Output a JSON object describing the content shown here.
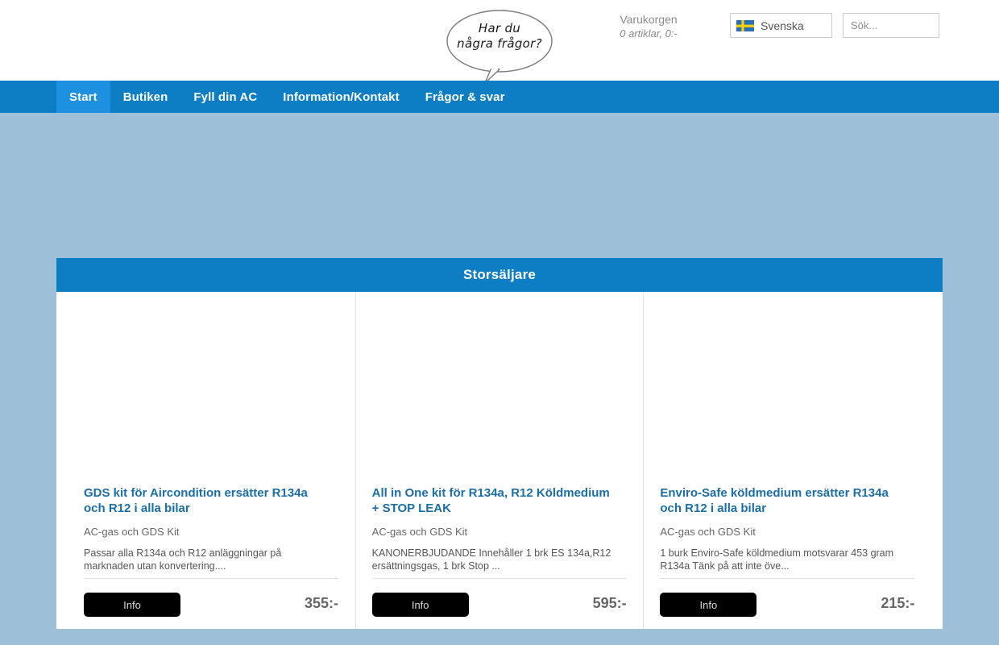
{
  "header": {
    "bubble": {
      "line1": "Har du",
      "line2": "några frågor?"
    },
    "cart": {
      "title": "Varukorgen",
      "summary": "0 artiklar, 0:-"
    },
    "language": {
      "label": "Svenska",
      "flag_icon": "swedish-flag-icon"
    },
    "search": {
      "value": "",
      "placeholder": "Sök..."
    }
  },
  "nav": {
    "items": [
      {
        "label": "Start",
        "active": true
      },
      {
        "label": "Butiken",
        "active": false
      },
      {
        "label": "Fyll din AC",
        "active": false
      },
      {
        "label": "Information/Kontakt",
        "active": false
      },
      {
        "label": "Frågor & svar",
        "active": false
      }
    ]
  },
  "panel": {
    "title": "Storsäljare",
    "products": [
      {
        "title": "GDS kit för Aircondition ersätter R134a och R12 i alla bilar",
        "category": "AC-gas och GDS Kit",
        "description": "Passar alla R134a och R12 anläggningar på marknaden utan konvertering....",
        "button_label": "Info",
        "price": "355:-"
      },
      {
        "title": "All in One kit för R134a, R12 Köldmedium + STOP LEAK",
        "category": "AC-gas och GDS Kit",
        "description": "KANONERBJUDANDE Innehåller 1 brk ES 134a,R12 ersättningsgas, 1 brk Stop ...",
        "button_label": "Info",
        "price": "595:-"
      },
      {
        "title": "Enviro-Safe köldmedium ersätter R134a och R12 i alla bilar",
        "category": "AC-gas och GDS Kit",
        "description": "1 burk Enviro-Safe köldmedium motsvarar 453 gram R134a Tänk på att inte öve...",
        "button_label": "Info",
        "price": "215:-"
      }
    ]
  },
  "colors": {
    "page_background": "#9dc0d8",
    "nav_blue": "#0d7ec4",
    "nav_active_blue": "#1e90e0",
    "title_link_blue": "#1c6ea4",
    "button_black": "#000000"
  }
}
